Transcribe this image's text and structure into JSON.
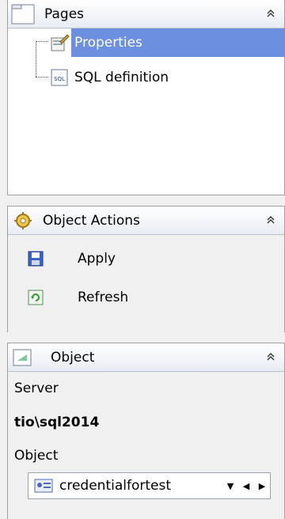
{
  "pages": {
    "title": "Pages",
    "items": [
      {
        "label": "Properties",
        "selected": true,
        "icon": "properties-icon"
      },
      {
        "label": "SQL definition",
        "selected": false,
        "icon": "sql-icon"
      }
    ]
  },
  "actions": {
    "title": "Object Actions",
    "items": [
      {
        "label": "Apply",
        "icon": "save-icon"
      },
      {
        "label": "Refresh",
        "icon": "refresh-icon"
      }
    ]
  },
  "object": {
    "title": "Object",
    "server_label": "Server",
    "server_value": "tio\\sql2014",
    "object_label": "Object",
    "object_value": "credentialfortest",
    "nav_down": "▼",
    "nav_prev": "◀",
    "nav_next": "▶"
  },
  "colors": {
    "selection": "#6d8fe0",
    "header_border": "#b9c0cc"
  }
}
